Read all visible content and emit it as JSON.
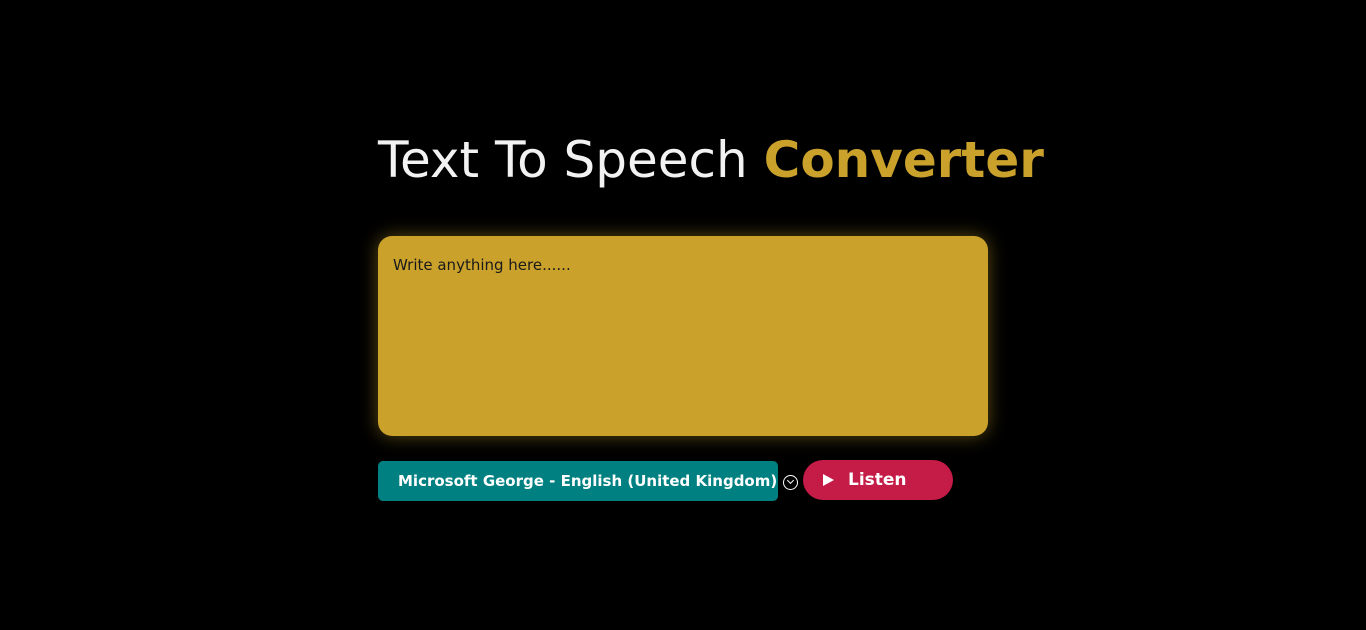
{
  "header": {
    "title_main": "Text To Speech ",
    "title_accent": "Converter"
  },
  "editor": {
    "placeholder": "Write anything here......",
    "value": ""
  },
  "voice_select": {
    "selected": "Microsoft George - English (United Kingdom)",
    "icon": "chevron-down-circle-icon"
  },
  "listen_button": {
    "label": "Listen",
    "icon": "play-icon"
  },
  "colors": {
    "background": "#000000",
    "title_text": "#f2f2f2",
    "accent": "#c9a12b",
    "select_bg": "#008080",
    "button_bg": "#c41b47"
  }
}
